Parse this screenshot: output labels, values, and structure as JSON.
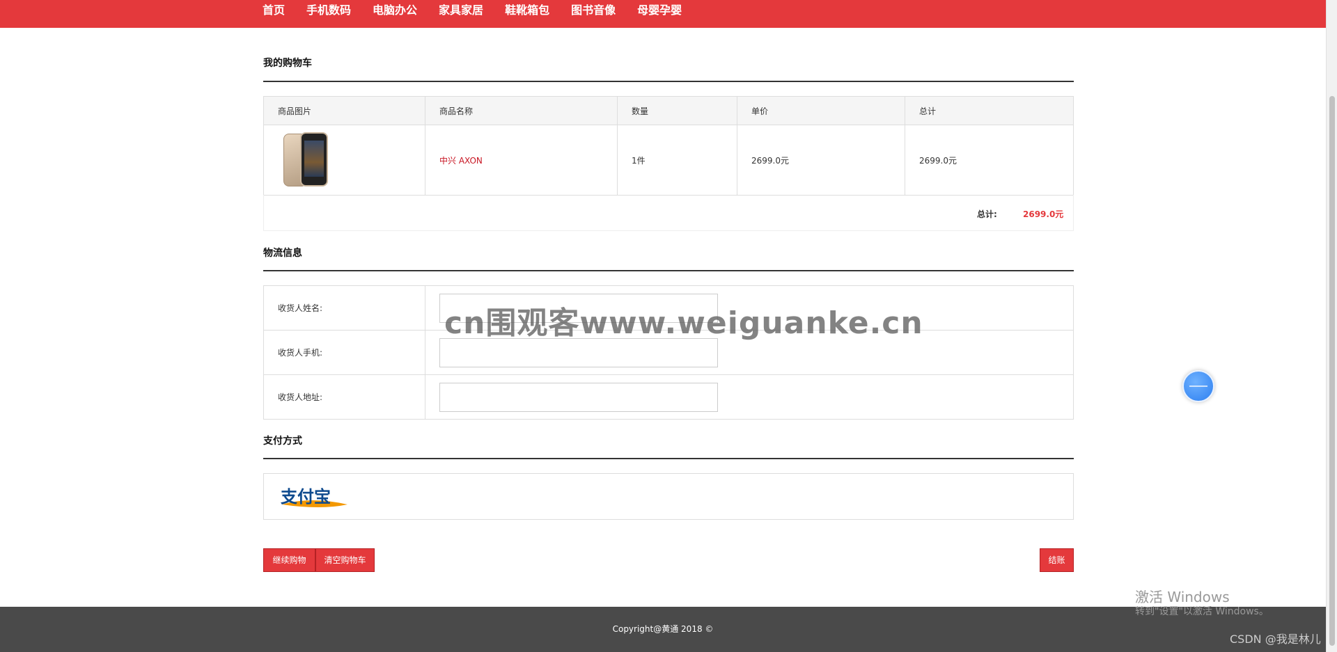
{
  "nav": {
    "items": [
      "首页",
      "手机数码",
      "电脑办公",
      "家具家居",
      "鞋靴箱包",
      "图书音像",
      "母婴孕婴"
    ]
  },
  "cart": {
    "title": "我的购物车",
    "headers": [
      "商品图片",
      "商品名称",
      "数量",
      "单价",
      "总计"
    ],
    "rows": [
      {
        "name": "中兴 AXON",
        "qty": "1件",
        "price": "2699.0元",
        "subtotal": "2699.0元"
      }
    ],
    "total_label": "总计:",
    "total_value": "2699.0元"
  },
  "shipping": {
    "title": "物流信息",
    "fields": [
      {
        "label": "收货人姓名:",
        "value": ""
      },
      {
        "label": "收货人手机:",
        "value": ""
      },
      {
        "label": "收货人地址:",
        "value": ""
      }
    ]
  },
  "payment": {
    "title": "支付方式",
    "logo_text": "支付宝"
  },
  "buttons": {
    "continue": "继续购物",
    "clear": "清空购物车",
    "checkout": "结账"
  },
  "footer": {
    "copyright": "Copyright@黄通 2018 ©"
  },
  "overlays": {
    "watermark": "cn围观客www.weiguanke.cn",
    "activate_title": "激活 Windows",
    "activate_sub": "转到\"设置\"以激活 Windows。",
    "csdn": "CSDN @我是林儿"
  },
  "colors": {
    "brand_red": "#e4393c",
    "footer_bg": "#4a4a4a"
  }
}
